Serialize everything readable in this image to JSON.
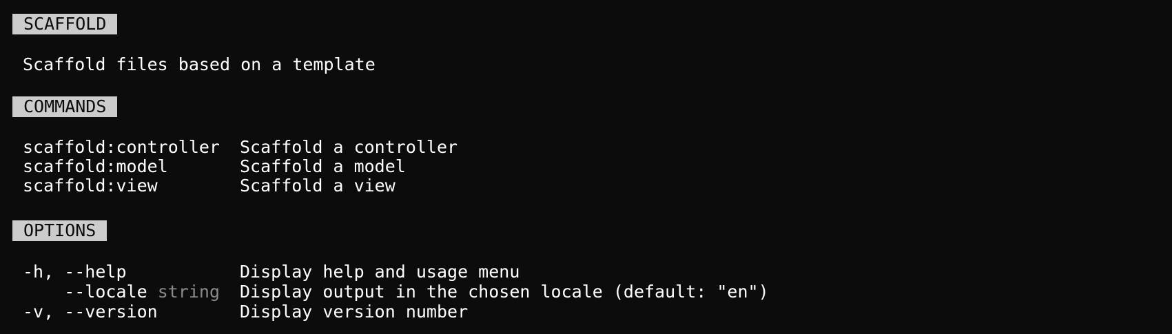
{
  "help": {
    "title_heading": "SCAFFOLD",
    "description": "Scaffold files based on a template",
    "commands_heading": "COMMANDS",
    "commands": [
      {
        "name": "scaffold:controller",
        "description": "Scaffold a controller"
      },
      {
        "name": "scaffold:model",
        "description": "Scaffold a model"
      },
      {
        "name": "scaffold:view",
        "description": "Scaffold a view"
      }
    ],
    "options_heading": "OPTIONS",
    "options": [
      {
        "flags": "-h, --help",
        "type": "",
        "description": "Display help and usage menu"
      },
      {
        "flags": "    --locale",
        "type": "string",
        "description": "Display output in the chosen locale (default: \"en\")"
      },
      {
        "flags": "-v, --version",
        "type": "",
        "description": "Display version number"
      }
    ]
  },
  "colors": {
    "background": "#0c0c0c",
    "text": "#ffffff",
    "heading_background": "#cccccc",
    "heading_text": "#0c0c0c",
    "dim_text": "#8a8a8a"
  }
}
